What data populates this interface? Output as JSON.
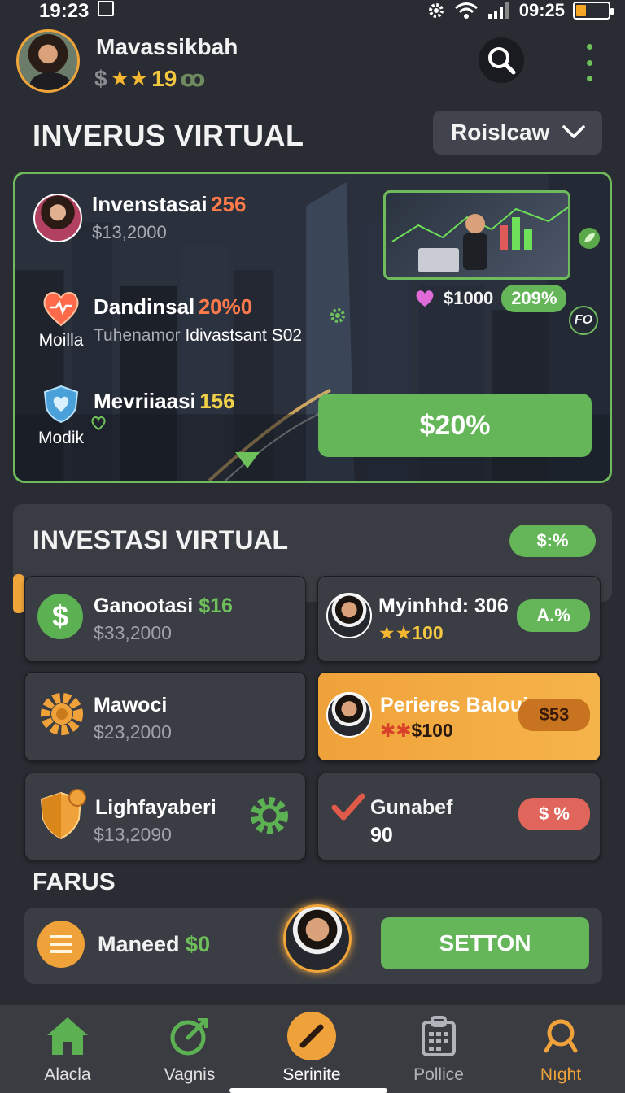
{
  "status_bar": {
    "time": "19:23",
    "clock": "09:25"
  },
  "header": {
    "user_name": "Mavassikbah",
    "currency_symbol": "$",
    "stars": "★★",
    "stat_value": "19",
    "stat_suffix": "ꝏ",
    "dropdown_value": "Roislcaw"
  },
  "title_main": "INVERUS VIRTUAL",
  "hero": {
    "row1": {
      "title": "Invenstasai",
      "accent": "256",
      "sub": "$13,2000"
    },
    "row2": {
      "label": "Moilla",
      "title": "Dandinsal",
      "accent": "20%0",
      "sub_a": "Tuhenamor",
      "sub_b": "Idivastsant S02"
    },
    "row3": {
      "label": "Modik",
      "title": "Mevriiaasi",
      "accent": "156"
    },
    "pic_price": "$1000",
    "pic_badge": "209%",
    "fo_badge": "FO",
    "cta": "$20%"
  },
  "section2": {
    "title": "INVESTASI VIRTUAL",
    "pill": "$:%",
    "cards": [
      {
        "title": "Ganootasi",
        "accent": "$16",
        "sub": "$33,2000"
      },
      {
        "title": "Myinhhd: 306",
        "stars": "★★",
        "value": "100",
        "pill": "A.%"
      },
      {
        "title": "Mawoci",
        "sub": "$23,2000"
      },
      {
        "title": "Perieres Baloui",
        "stars": "✱✱",
        "value": "$100",
        "pill": "$53"
      },
      {
        "title": "Lighfayaberi",
        "sub": "$13,2090"
      },
      {
        "title": "Gunabef",
        "sub": "90",
        "pill": "$ %"
      }
    ]
  },
  "section3": {
    "title": "FARUS",
    "label": "Maneed",
    "accent": "$0",
    "button": "SETTON"
  },
  "bottom_nav": [
    {
      "label": "Alacla",
      "icon": "home-icon"
    },
    {
      "label": "Vagnis",
      "icon": "target-icon"
    },
    {
      "label": "Serinite",
      "icon": "pen-icon"
    },
    {
      "label": "Pollice",
      "icon": "calendar-icon"
    },
    {
      "label": "Nıgħt",
      "icon": "search-icon"
    }
  ],
  "colors": {
    "background": "#2a2c33",
    "accent_green": "#64b658",
    "accent_orange": "#f0a23a",
    "accent_red": "#ff7a4a",
    "accent_yellow": "#f2d14a"
  }
}
